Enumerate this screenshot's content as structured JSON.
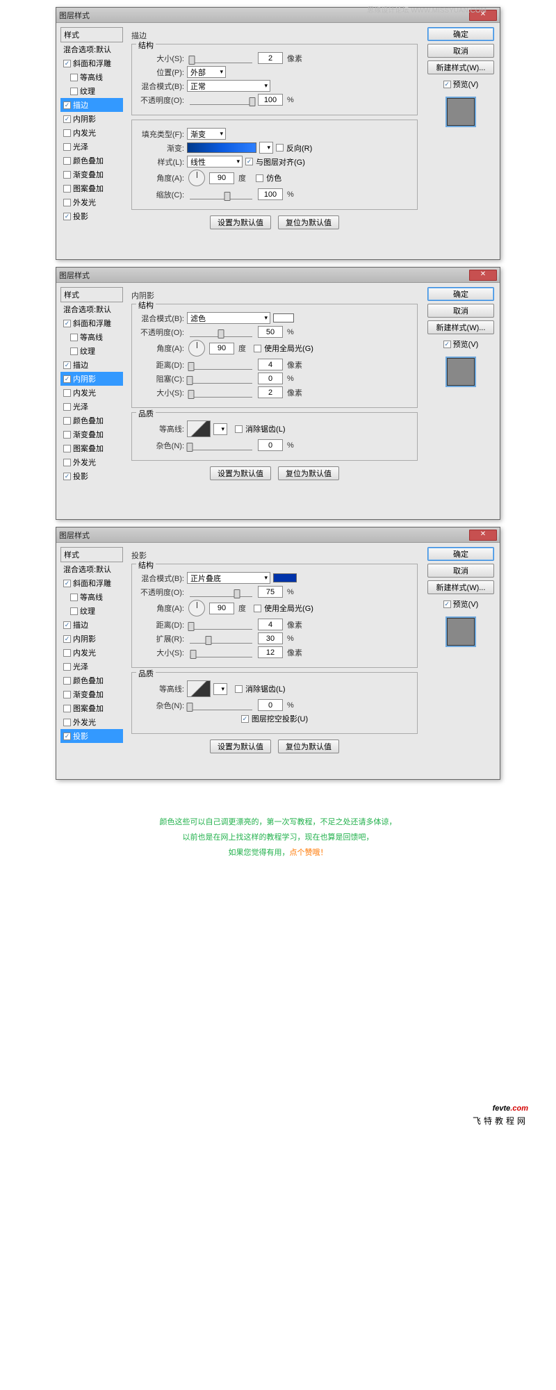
{
  "watermark": "思缘设计论坛 WWW.MISSYUAN.COM",
  "dialog_title": "图层样式",
  "styles_header": "样式",
  "styles_sub": "混合选项:默认",
  "style_items": [
    {
      "label": "斜面和浮雕",
      "chk": true
    },
    {
      "label": "等高线",
      "chk": false,
      "indent": true
    },
    {
      "label": "纹理",
      "chk": false,
      "indent": true
    },
    {
      "label": "描边",
      "chk": true
    },
    {
      "label": "内阴影",
      "chk": true
    },
    {
      "label": "内发光",
      "chk": false
    },
    {
      "label": "光泽",
      "chk": false
    },
    {
      "label": "颜色叠加",
      "chk": false
    },
    {
      "label": "渐变叠加",
      "chk": false
    },
    {
      "label": "图案叠加",
      "chk": false
    },
    {
      "label": "外发光",
      "chk": false
    },
    {
      "label": "投影",
      "chk": true
    }
  ],
  "buttons": {
    "ok": "确定",
    "cancel": "取消",
    "new_style": "新建样式(W)...",
    "preview": "预览(V)",
    "default": "设置为默认值",
    "reset": "复位为默认值"
  },
  "stroke": {
    "title": "描边",
    "group1": "结构",
    "size_l": "大小(S):",
    "size_v": "2",
    "size_u": "像素",
    "pos_l": "位置(P):",
    "pos_v": "外部",
    "blend_l": "混合模式(B):",
    "blend_v": "正常",
    "opac_l": "不透明度(O):",
    "opac_v": "100",
    "opac_u": "%",
    "fill_l": "填充类型(F):",
    "fill_v": "渐变",
    "grad_l": "渐变:",
    "rev": "反向(R)",
    "style_l": "样式(L):",
    "style_v": "线性",
    "align": "与图层对齐(G)",
    "ang_l": "角度(A):",
    "ang_v": "90",
    "ang_u": "度",
    "dither": "仿色",
    "scale_l": "缩放(C):",
    "scale_v": "100",
    "scale_u": "%"
  },
  "inner_shadow": {
    "title": "内阴影",
    "group1": "结构",
    "group2": "品质",
    "blend_l": "混合模式(B):",
    "blend_v": "滤色",
    "opac_l": "不透明度(O):",
    "opac_v": "50",
    "opac_u": "%",
    "ang_l": "角度(A):",
    "ang_v": "90",
    "ang_u": "度",
    "global": "使用全局光(G)",
    "dist_l": "距离(D):",
    "dist_v": "4",
    "dist_u": "像素",
    "choke_l": "阻塞(C):",
    "choke_v": "0",
    "choke_u": "%",
    "size_l": "大小(S):",
    "size_v": "2",
    "size_u": "像素",
    "contour_l": "等高线:",
    "aa": "消除锯齿(L)",
    "noise_l": "杂色(N):",
    "noise_v": "0",
    "noise_u": "%"
  },
  "drop_shadow": {
    "title": "投影",
    "group1": "结构",
    "group2": "品质",
    "blend_l": "混合模式(B):",
    "blend_v": "正片叠底",
    "opac_l": "不透明度(O):",
    "opac_v": "75",
    "opac_u": "%",
    "ang_l": "角度(A):",
    "ang_v": "90",
    "ang_u": "度",
    "global": "使用全局光(G)",
    "dist_l": "距离(D):",
    "dist_v": "4",
    "dist_u": "像素",
    "spread_l": "扩展(R):",
    "spread_v": "30",
    "spread_u": "%",
    "size_l": "大小(S):",
    "size_v": "12",
    "size_u": "像素",
    "contour_l": "等高线:",
    "aa": "消除锯齿(L)",
    "noise_l": "杂色(N):",
    "noise_v": "0",
    "noise_u": "%",
    "knockout": "图层挖空投影(U)"
  },
  "footer": {
    "l1": "颜色这些可以自己调更漂亮的，第一次写教程，不足之处还请多体谅，",
    "l2": "以前也是在网上找这样的教程学习，现在也算是回馈吧，",
    "l3a": "如果您觉得有用，",
    "l3b": "点个赞哦！"
  },
  "logo": {
    "a": "fevte",
    "b": ".com",
    "sub": "飞特教程网"
  }
}
